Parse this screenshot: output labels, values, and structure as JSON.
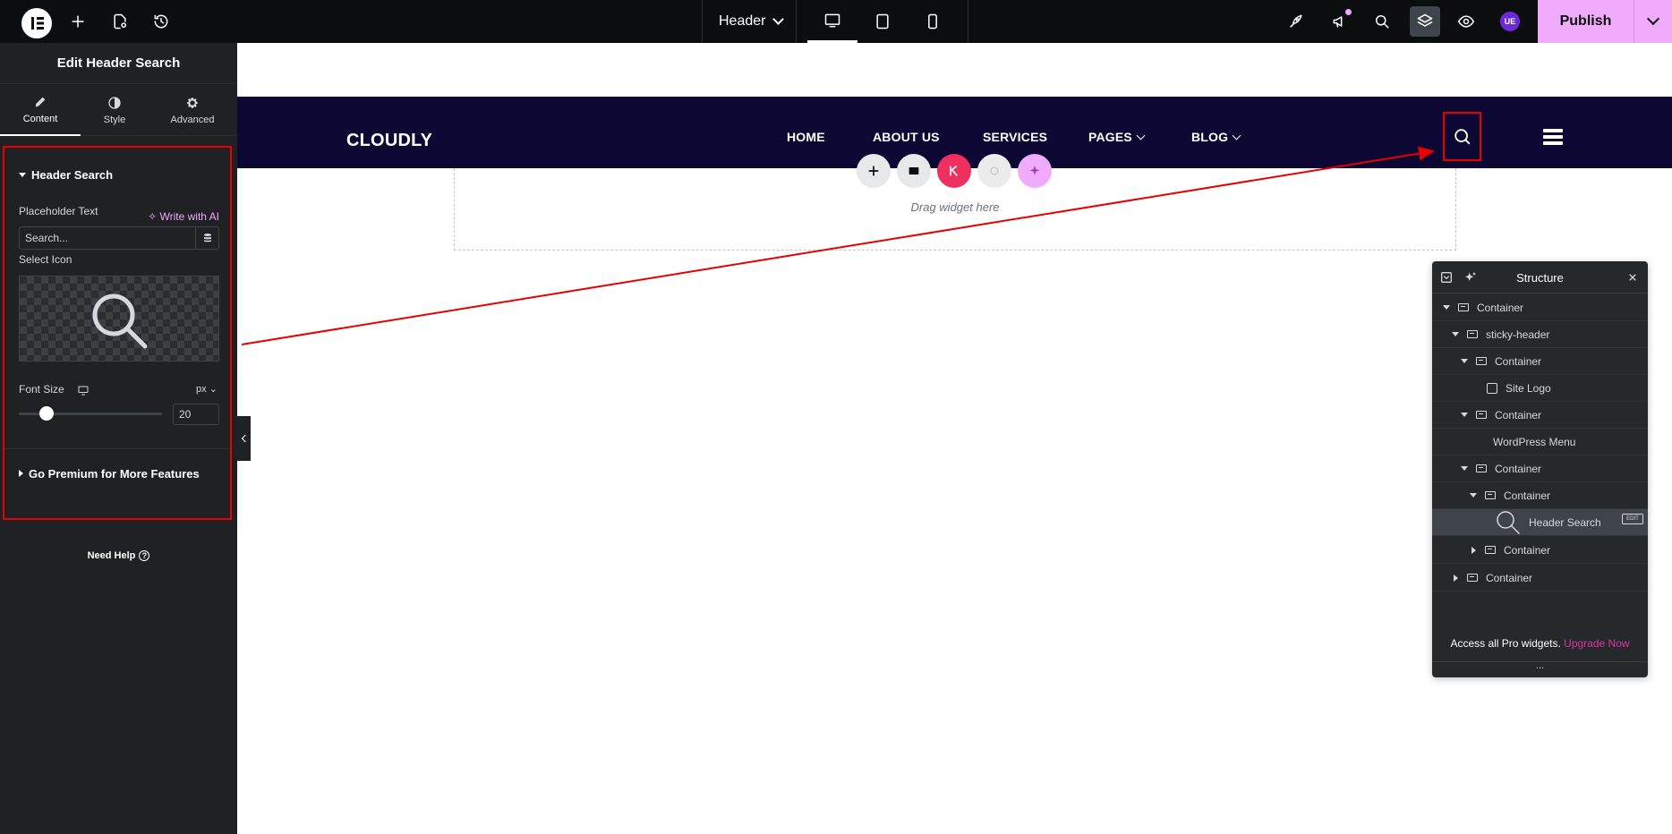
{
  "topbar": {
    "icons": [
      "elementor-logo-icon",
      "plus-icon",
      "page-settings-icon",
      "history-icon"
    ],
    "document_name": "Header",
    "devices": [
      "desktop-icon",
      "tablet-icon",
      "mobile-icon"
    ],
    "right_icons": [
      "rocket-icon",
      "megaphone-icon",
      "search-icon",
      "layers-icon",
      "eye-icon"
    ],
    "avatar_initials": "UE",
    "publish_label": "Publish",
    "publish_color": "#f0abfc"
  },
  "panel": {
    "title": "Edit Header Search",
    "tabs": [
      {
        "label": "Content",
        "icon": "pencil-icon"
      },
      {
        "label": "Style",
        "icon": "half-circle-icon"
      },
      {
        "label": "Advanced",
        "icon": "gear-icon"
      }
    ],
    "section_title": "Header Search",
    "placeholder_label": "Placeholder Text",
    "write_ai": "Write with AI",
    "placeholder_value": "Search...",
    "select_icon_label": "Select Icon",
    "font_size_label": "Font Size",
    "font_size_unit": "px",
    "font_size_value": "20",
    "premium_section": "Go Premium for More Features",
    "need_help": "Need Help",
    "need_help_icon": "?"
  },
  "site": {
    "logo": "CLOUDLY",
    "nav": [
      {
        "label": "HOME"
      },
      {
        "label": "ABOUT US"
      },
      {
        "label": "SERVICES"
      },
      {
        "label": "PAGES"
      },
      {
        "label": "BLOG"
      }
    ],
    "header_bg": "#0c0733",
    "drop_text": "Drag widget here"
  },
  "structure": {
    "title": "Structure",
    "items": [
      {
        "label": "Container"
      },
      {
        "label": "sticky-header"
      },
      {
        "label": "Container"
      },
      {
        "label": "Site Logo"
      },
      {
        "label": "Container"
      },
      {
        "label": "WordPress Menu"
      },
      {
        "label": "Container"
      },
      {
        "label": "Container"
      },
      {
        "label": "Header Search"
      },
      {
        "label": "Container"
      },
      {
        "label": "Container"
      }
    ],
    "footer_text": "Access all Pro widgets.",
    "footer_link": "Upgrade Now",
    "dots": "...",
    "edit_badge": "EDIT"
  }
}
